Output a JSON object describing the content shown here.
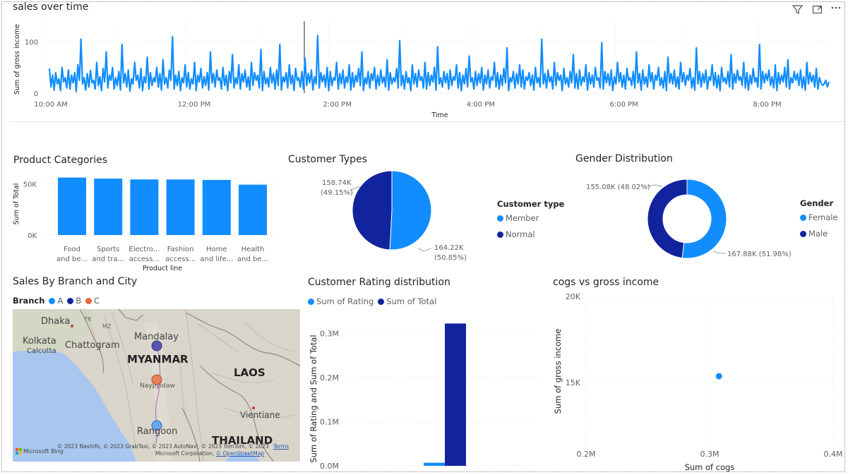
{
  "visuals": {
    "sales_over_time": {
      "title": "sales over time"
    },
    "product_categories": {
      "title": "Product Categories"
    },
    "customer_types": {
      "title": "Customer Types"
    },
    "gender_distribution": {
      "title": "Gender Distribution"
    },
    "sales_by_branch": {
      "title": "Sales By Branch and City"
    },
    "rating_distribution": {
      "title": "Customer Rating distribution"
    },
    "cogs_vs_income": {
      "title": "cogs vs gross income"
    }
  },
  "header_icons": [
    "filter-icon",
    "focus-mode-icon",
    "more-options-icon"
  ],
  "colors": {
    "light_blue": "#118DFF",
    "dark_blue": "#12239E",
    "orange": "#E66C37",
    "text": "#252423",
    "muted": "#605e5c"
  },
  "customer_legend": {
    "title": "Customer type",
    "items": [
      "Member",
      "Normal"
    ]
  },
  "gender_legend": {
    "title": "Gender",
    "items": [
      "Female",
      "Male"
    ]
  },
  "branch_legend": {
    "title": "Branch",
    "items": [
      "A",
      "B",
      "C"
    ]
  },
  "rating_legend": {
    "items": [
      "Sum of Rating",
      "Sum of Total"
    ]
  },
  "map": {
    "labels": [
      "Dhaka",
      "Kolkata",
      "Calcutta",
      "Chattogram",
      "Mandalay",
      "MYANMAR",
      "Naypyidaw",
      "LAOS",
      "Vientiane",
      "Rangoon",
      "THAILAND",
      "TR",
      "MZ"
    ],
    "brand": "Microsoft Bing",
    "copyright": "© 2023 NavInfo, © 2023 GrabTaxi, © 2023 AutoNavi, © 2023 TomTom, © 2023",
    "copyright2": "Microsoft Corporation, ",
    "osm": "© OpenStreetMap",
    "terms": "Terms"
  },
  "chart_data": [
    {
      "type": "line",
      "title": "sales over time",
      "xlabel": "Time",
      "ylabel": "Sum of gross income",
      "x_ticks": [
        "10:00 AM",
        "12:00 PM",
        "2:00 PM",
        "4:00 PM",
        "6:00 PM",
        "8:00 PM"
      ],
      "y_ticks": [
        "0",
        "100"
      ],
      "ylim": [
        0,
        140
      ],
      "xlim": [
        "10:00 AM",
        "9:00 PM"
      ],
      "values": [
        48,
        12,
        35,
        6,
        40,
        18,
        28,
        5,
        50,
        22,
        30,
        10,
        45,
        8,
        35,
        20,
        40,
        3,
        55,
        25,
        105,
        18,
        30,
        6,
        38,
        12,
        44,
        20,
        25,
        8,
        60,
        15,
        32,
        5,
        48,
        22,
        80,
        10,
        35,
        25,
        50,
        8,
        30,
        15,
        42,
        6,
        95,
        20,
        38,
        12,
        45,
        4,
        28,
        18,
        60,
        25,
        35,
        10,
        48,
        5,
        32,
        20,
        70,
        8,
        40,
        15,
        30,
        22,
        50,
        12,
        38,
        6,
        65,
        18,
        30,
        10,
        45,
        25,
        110,
        8,
        35,
        15,
        42,
        5,
        30,
        20,
        55,
        12,
        40,
        8,
        28,
        18,
        60,
        5,
        35,
        22,
        48,
        10,
        32,
        15,
        40,
        6,
        80,
        20,
        38,
        12,
        45,
        25,
        30,
        8,
        50,
        15,
        35,
        5,
        42,
        20,
        75,
        10,
        30,
        18,
        55,
        8,
        38,
        22,
        45,
        12,
        32,
        6,
        60,
        15,
        40,
        25,
        35,
        10,
        85,
        5,
        42,
        18,
        30,
        12,
        50,
        20,
        38,
        8,
        45,
        15,
        95,
        6,
        32,
        22,
        40,
        10,
        55,
        18,
        35,
        5,
        48,
        25,
        30,
        12,
        42,
        8,
        68,
        15,
        38,
        20,
        45,
        6,
        32,
        18,
        112,
        10,
        40,
        22,
        35,
        12,
        50,
        5,
        42,
        15,
        30,
        25,
        60,
        8,
        38,
        18,
        45,
        10,
        32,
        20,
        55,
        6,
        40,
        12,
        35,
        22,
        48,
        15,
        80,
        5,
        30,
        18,
        42,
        10,
        38,
        25,
        50,
        8,
        35,
        15,
        45,
        20,
        32,
        12,
        65,
        6,
        40,
        18,
        30,
        22,
        48,
        10,
        102,
        15,
        35,
        8,
        42,
        20,
        30,
        5,
        55,
        18,
        38,
        12,
        45,
        25,
        32,
        10,
        60,
        8,
        40,
        15,
        35,
        22,
        50,
        6,
        90,
        18,
        30,
        12,
        42,
        20,
        38,
        8,
        45,
        15,
        32,
        25,
        55,
        10,
        40,
        5,
        35,
        18,
        48,
        12,
        72,
        22,
        30,
        8,
        42,
        15,
        38,
        20,
        50,
        6,
        35,
        18,
        45,
        10,
        32,
        25,
        60,
        12,
        40,
        8,
        35,
        15,
        48,
        20,
        88,
        5,
        30,
        22,
        42,
        10,
        38,
        18,
        55,
        12,
        45,
        8,
        32,
        25,
        40,
        15,
        35,
        6,
        50,
        20,
        30,
        12,
        105,
        18,
        38,
        10,
        45,
        22,
        32,
        8,
        60,
        15,
        40,
        25,
        35,
        5,
        48,
        18,
        30,
        12,
        42,
        20,
        75,
        10,
        38,
        8,
        45,
        15,
        32,
        22,
        55,
        6,
        40,
        18,
        35,
        12,
        50,
        25,
        30,
        10,
        98,
        8,
        42,
        20,
        38,
        15,
        45,
        5,
        32,
        18,
        60,
        22,
        40,
        12,
        35,
        8,
        48,
        25,
        30,
        15,
        42,
        10,
        80,
        20,
        38,
        6,
        45,
        18,
        32,
        12,
        55,
        22,
        40,
        8,
        35,
        25,
        50,
        15,
        30,
        10,
        42,
        5,
        70,
        20,
        38,
        18,
        45,
        12,
        32,
        8,
        60,
        22,
        40,
        15,
        35,
        25,
        48,
        10,
        30,
        6,
        88,
        18,
        42,
        12,
        38,
        20,
        45,
        8,
        32,
        25,
        55,
        15,
        40,
        10,
        35,
        5,
        50,
        22,
        30,
        18,
        42,
        12,
        75,
        8,
        38,
        20,
        45,
        25,
        32,
        15,
        60,
        10,
        40,
        6,
        35,
        18,
        48,
        22,
        30,
        12,
        95,
        8,
        42,
        20,
        38,
        25,
        45,
        15,
        32,
        10,
        55,
        5,
        40,
        18,
        35,
        22,
        50,
        12,
        65,
        8,
        30,
        20,
        42,
        25,
        38,
        15,
        45,
        10,
        32,
        6,
        60,
        18,
        40,
        22,
        35,
        12,
        48,
        8,
        30,
        20,
        15,
        18,
        25,
        12,
        22
      ]
    },
    {
      "type": "bar",
      "title": "Product Categories",
      "xlabel": "Product line",
      "ylabel": "Sum of Total",
      "categories": [
        "Food and be...",
        "Sports and tra...",
        "Electro... access...",
        "Fashion access...",
        "Home and life...",
        "Health and be..."
      ],
      "category_lines": [
        [
          "Food",
          "and be..."
        ],
        [
          "Sports",
          "and tra..."
        ],
        [
          "Electro...",
          "access..."
        ],
        [
          "Fashion",
          "access..."
        ],
        [
          "Home",
          "and life..."
        ],
        [
          "Health",
          "and be..."
        ]
      ],
      "values": [
        56144,
        55123,
        54337,
        54306,
        53862,
        49193
      ],
      "y_ticks": [
        "0K",
        "50K"
      ],
      "ylim": [
        0,
        60000
      ]
    },
    {
      "type": "pie",
      "title": "Customer Types",
      "legend_title": "Customer type",
      "categories": [
        "Member",
        "Normal"
      ],
      "values": [
        164.22,
        158.74
      ],
      "value_unit": "K",
      "labels": [
        [
          "164.22K",
          "(50.85%)"
        ],
        [
          "158.74K",
          "(49.15%)"
        ]
      ]
    },
    {
      "type": "pie",
      "variant": "donut",
      "title": "Gender Distribution",
      "legend_title": "Gender",
      "categories": [
        "Female",
        "Male"
      ],
      "values": [
        167.88,
        155.08
      ],
      "value_unit": "K",
      "labels": [
        "167.88K (51.98%)",
        "155.08K (48.02%)"
      ]
    },
    {
      "type": "bar",
      "title": "Customer Rating distribution",
      "ylabel": "Sum of Rating and Sum of Total",
      "series": [
        {
          "name": "Sum of Rating",
          "values": [
            6972.7
          ]
        },
        {
          "name": "Sum of Total",
          "values": [
            322966.7
          ]
        }
      ],
      "y_ticks": [
        "0.0M",
        "0.1M",
        "0.2M",
        "0.3M"
      ],
      "ylim": [
        0,
        330000
      ]
    },
    {
      "type": "scatter",
      "title": "cogs vs gross income",
      "xlabel": "Sum of cogs",
      "ylabel": "Sum of gross income",
      "x": [
        307587
      ],
      "y": [
        15379
      ],
      "x_ticks": [
        "0.2M",
        "0.3M",
        "0.4M"
      ],
      "y_ticks": [
        "15K",
        "20K"
      ],
      "xlim": [
        200000,
        400000
      ],
      "ylim": [
        11000,
        20000
      ]
    }
  ]
}
